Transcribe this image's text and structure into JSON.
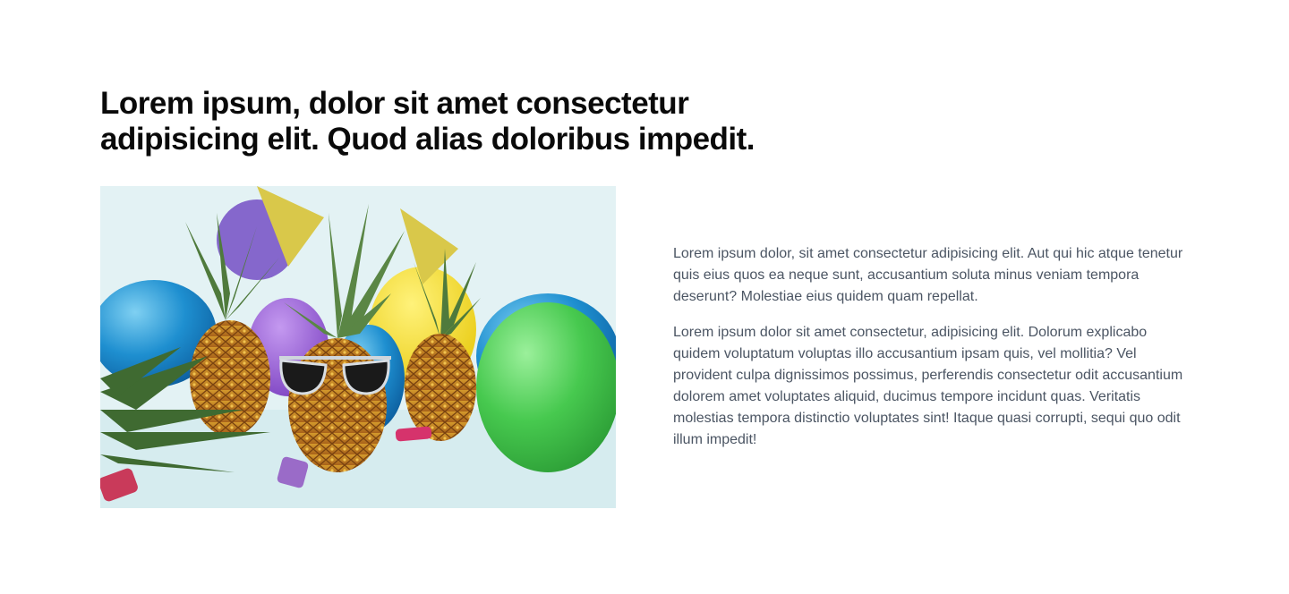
{
  "section": {
    "heading": "Lorem ipsum, dolor sit amet consectetur adipisicing elit. Quod alias doloribus impedit.",
    "image_alt": "Pineapples wearing party hats and sunglasses among colorful balloons",
    "paragraphs": [
      "Lorem ipsum dolor, sit amet consectetur adipisicing elit. Aut qui hic atque tenetur quis eius quos ea neque sunt, accusantium soluta minus veniam tempora deserunt? Molestiae eius quidem quam repellat.",
      "Lorem ipsum dolor sit amet consectetur, adipisicing elit. Dolorum explicabo quidem voluptatum voluptas illo accusantium ipsam quis, vel mollitia? Vel provident culpa dignissimos possimus, perferendis consectetur odit accusantium dolorem amet voluptates aliquid, ducimus tempore incidunt quas. Veritatis molestias tempora distinctio voluptates sint! Itaque quasi corrupti, sequi quo odit illum impedit!"
    ]
  },
  "colors": {
    "heading": "#0a0a0a",
    "body_text": "#4b5563",
    "background": "#ffffff"
  }
}
